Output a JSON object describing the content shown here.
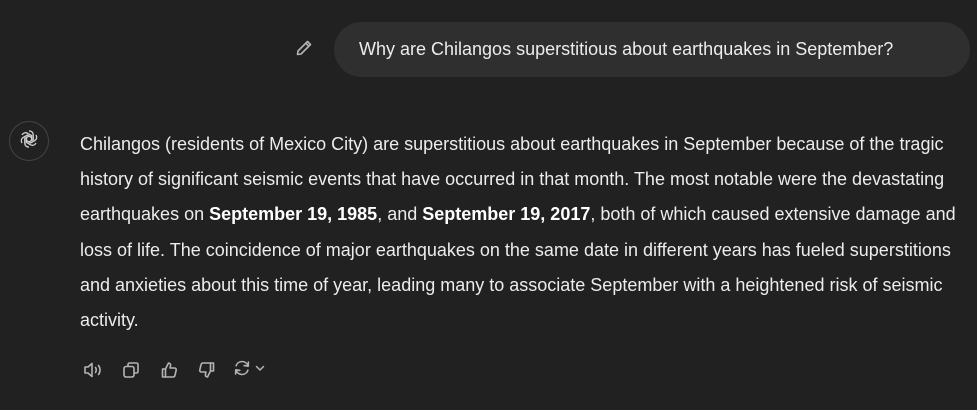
{
  "conversation": {
    "user_message": "Why are Chilangos superstitious about earthquakes in September?",
    "assistant": {
      "parts": [
        "Chilangos (residents of Mexico City) are superstitious about earthquakes in September because of the tragic history of significant seismic events that have occurred in that month. The most notable were the devastating earthquakes on ",
        "September 19, 1985",
        ", and ",
        "September 19, 2017",
        ", both of which caused extensive damage and loss of life. The coincidence of major earthquakes on the same date in different years has fueled superstitions and anxieties about this time of year, leading many to associate September with a heightened risk of seismic activity."
      ]
    }
  },
  "icons": {
    "edit": "pencil-icon",
    "avatar": "chatgpt-logo-icon",
    "read_aloud": "speaker-icon",
    "copy": "copy-icon",
    "thumbs_up": "thumbs-up-icon",
    "thumbs_down": "thumbs-down-icon",
    "regenerate": "refresh-icon",
    "model_menu": "chevron-down-icon"
  },
  "colors": {
    "background": "#212121",
    "user_bubble": "#2f2f2f",
    "text": "#ececec",
    "icon": "#b4b4b4"
  }
}
